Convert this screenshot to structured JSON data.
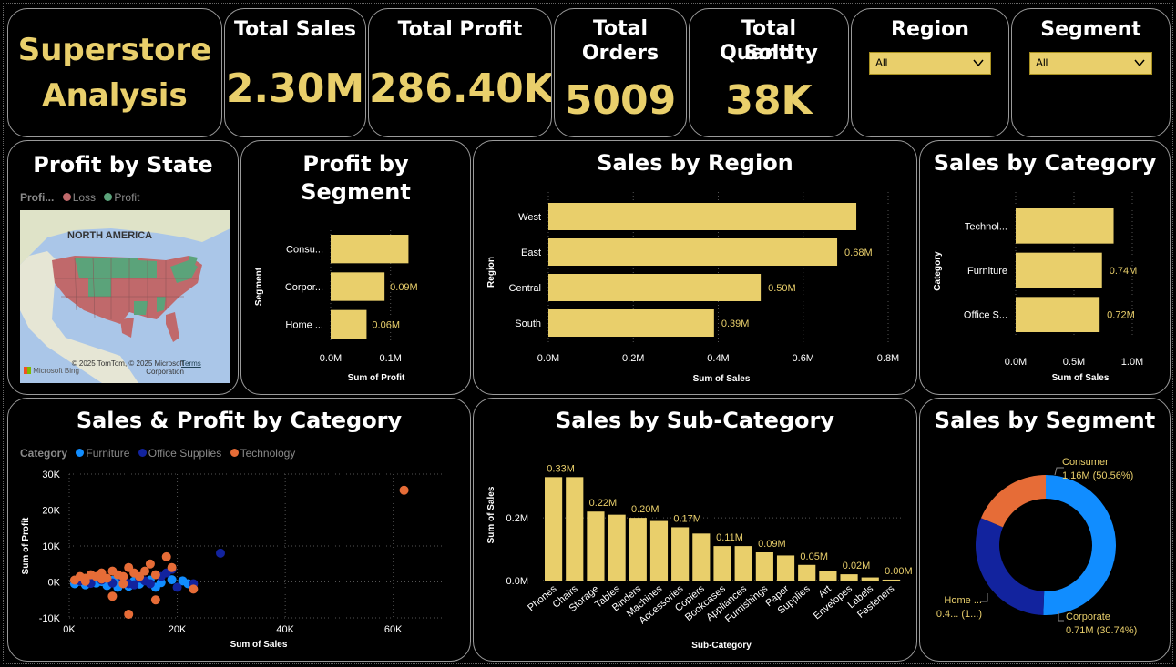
{
  "brand": {
    "line1": "Superstore",
    "line2": "Analysis"
  },
  "kpis": [
    {
      "label": "Total Sales",
      "value": "2.30M"
    },
    {
      "label": "Total Profit",
      "value": "286.40K"
    },
    {
      "label_line1": "Total",
      "label_line2": "Orders",
      "value": "5009"
    },
    {
      "label_line1": "Total Quantity",
      "label_line2": "Sold",
      "value": "38K"
    }
  ],
  "slicers": {
    "region": {
      "label": "Region",
      "value": "All"
    },
    "segment": {
      "label": "Segment",
      "value": "All"
    }
  },
  "colors": {
    "accent": "#e9cf6b",
    "loss": "#c0696b",
    "profit": "#5ba37a",
    "furniture": "#118dff",
    "office": "#12239e",
    "technology": "#e66c37"
  },
  "profit_by_state": {
    "title": "Profit by State",
    "legend_title": "Profi...",
    "legend": [
      "Loss",
      "Profit"
    ],
    "map_label": "NORTH AMERICA",
    "attribution": "© 2025 TomTom, © 2025 Microsoft Corporation",
    "terms": "Terms",
    "bing": "Microsoft Bing"
  },
  "chart_data": [
    {
      "id": "profit_by_segment",
      "type": "bar",
      "orientation": "horizontal",
      "title": "Profit by Segment",
      "categories": [
        "Consu...",
        "Corpor...",
        "Home ..."
      ],
      "values": [
        0.13,
        0.09,
        0.06
      ],
      "data_labels": [
        "",
        "0.09M",
        "0.06M"
      ],
      "xlabel": "Sum of Profit",
      "ylabel": "Segment",
      "xticks": [
        "0.0M",
        "0.1M"
      ],
      "xlim": [
        0,
        0.14
      ]
    },
    {
      "id": "sales_by_region",
      "type": "bar",
      "orientation": "horizontal",
      "title": "Sales by Region",
      "categories": [
        "West",
        "East",
        "Central",
        "South"
      ],
      "values": [
        0.725,
        0.68,
        0.5,
        0.39
      ],
      "data_labels": [
        "",
        "0.68M",
        "0.50M",
        "0.39M"
      ],
      "xlabel": "Sum of Sales",
      "ylabel": "Region",
      "xticks": [
        "0.0M",
        "0.2M",
        "0.4M",
        "0.6M",
        "0.8M"
      ],
      "xlim": [
        0,
        0.8
      ]
    },
    {
      "id": "sales_by_category",
      "type": "bar",
      "orientation": "horizontal",
      "title": "Sales by Category",
      "categories": [
        "Technol...",
        "Furniture",
        "Office S..."
      ],
      "values": [
        0.84,
        0.74,
        0.72
      ],
      "data_labels": [
        "",
        "0.74M",
        "0.72M"
      ],
      "xlabel": "Sum of Sales",
      "ylabel": "Category",
      "xticks": [
        "0.0M",
        "0.5M",
        "1.0M"
      ],
      "xlim": [
        0,
        1.0
      ]
    },
    {
      "id": "sales_profit_by_category",
      "type": "scatter",
      "title": "Sales & Profit by Category",
      "legend_title": "Category",
      "xlabel": "Sum of Sales",
      "ylabel": "Sum of Profit",
      "xticks": [
        "0K",
        "20K",
        "40K",
        "60K"
      ],
      "yticks": [
        "30K",
        "20K",
        "10K",
        "0K",
        "-10K"
      ],
      "xlim": [
        0,
        70
      ],
      "ylim": [
        -10,
        30
      ],
      "series": [
        {
          "name": "Furniture",
          "points": [
            [
              1,
              -0.5
            ],
            [
              2,
              0.2
            ],
            [
              3,
              -0.8
            ],
            [
              4,
              0.5
            ],
            [
              5,
              -0.3
            ],
            [
              6,
              0.1
            ],
            [
              7,
              -1
            ],
            [
              8,
              0.4
            ],
            [
              9,
              -0.5
            ],
            [
              10,
              0.8
            ],
            [
              11,
              -1.2
            ],
            [
              12,
              0.2
            ],
            [
              13,
              -0.6
            ],
            [
              15,
              0.5
            ],
            [
              16,
              -1.5
            ],
            [
              17,
              -0.2
            ],
            [
              19,
              0.6
            ],
            [
              21,
              0.3
            ],
            [
              22,
              -0.5
            ],
            [
              5,
              1
            ],
            [
              7,
              0.6
            ],
            [
              9,
              -1.5
            ],
            [
              13,
              0.9
            ]
          ]
        },
        {
          "name": "Office Supplies",
          "points": [
            [
              2,
              0.3
            ],
            [
              4,
              -0.4
            ],
            [
              6,
              0.5
            ],
            [
              8,
              -0.3
            ],
            [
              10,
              0.6
            ],
            [
              12,
              -0.8
            ],
            [
              14,
              0.3
            ],
            [
              15,
              -0.5
            ],
            [
              17,
              1.5
            ],
            [
              18,
              2.5
            ],
            [
              19,
              3.5
            ],
            [
              20,
              -1.5
            ],
            [
              23,
              -0.5
            ],
            [
              28,
              8
            ],
            [
              11,
              -0.5
            ],
            [
              13,
              1
            ]
          ]
        },
        {
          "name": "Technology",
          "points": [
            [
              1,
              0.5
            ],
            [
              2,
              1.5
            ],
            [
              3,
              1
            ],
            [
              4,
              2
            ],
            [
              5,
              1.5
            ],
            [
              6,
              2.5
            ],
            [
              7,
              1
            ],
            [
              8,
              3
            ],
            [
              9,
              2
            ],
            [
              10,
              1.5
            ],
            [
              11,
              4
            ],
            [
              12,
              2.5
            ],
            [
              13,
              1.5
            ],
            [
              14,
              3
            ],
            [
              15,
              5
            ],
            [
              16,
              2
            ],
            [
              18,
              7
            ],
            [
              19,
              4
            ],
            [
              10,
              -0.5
            ],
            [
              8,
              -4
            ],
            [
              11,
              -9
            ],
            [
              16,
              -5
            ],
            [
              23,
              -2
            ],
            [
              62,
              25.5
            ],
            [
              3,
              0.2
            ],
            [
              6,
              0.8
            ]
          ]
        }
      ]
    },
    {
      "id": "sales_by_subcategory",
      "type": "bar",
      "title": "Sales by Sub-Category",
      "categories": [
        "Phones",
        "Chairs",
        "Storage",
        "Tables",
        "Binders",
        "Machines",
        "Accessories",
        "Copiers",
        "Bookcases",
        "Appliances",
        "Furnishings",
        "Paper",
        "Supplies",
        "Art",
        "Envelopes",
        "Labels",
        "Fasteners"
      ],
      "values": [
        0.33,
        0.33,
        0.22,
        0.21,
        0.2,
        0.19,
        0.17,
        0.15,
        0.11,
        0.11,
        0.09,
        0.08,
        0.05,
        0.03,
        0.02,
        0.01,
        0.003
      ],
      "data_labels": [
        "0.33M",
        "",
        "0.22M",
        "",
        "0.20M",
        "",
        "0.17M",
        "",
        "0.11M",
        "",
        "0.09M",
        "",
        "0.05M",
        "",
        "0.02M",
        "",
        "0.00M"
      ],
      "xlabel": "Sub-Category",
      "ylabel": "Sum of Sales",
      "yticks": [
        "0.2M",
        "0.0M"
      ],
      "ylim": [
        0,
        0.36
      ]
    },
    {
      "id": "sales_by_segment",
      "type": "pie",
      "donut": true,
      "title": "Sales by Segment",
      "slices": [
        {
          "name": "Consumer",
          "value": 50.56,
          "label_line1": "Consumer",
          "label_line2": "1.16M (50.56%)"
        },
        {
          "name": "Corporate",
          "value": 30.74,
          "label_line1": "Corporate",
          "label_line2": "0.71M (30.74%)"
        },
        {
          "name": "Home Office",
          "value": 18.7,
          "label_line1": "Home ...",
          "label_line2": "0.4... (1...)"
        }
      ]
    }
  ]
}
